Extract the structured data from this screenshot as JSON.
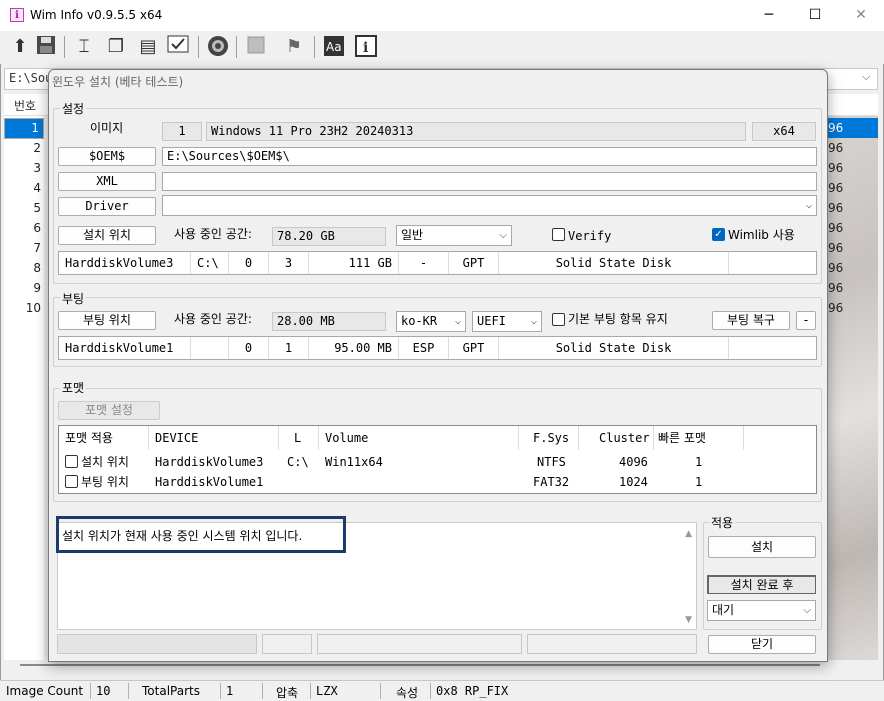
{
  "window": {
    "title": "Wim Info v0.9.5.5 x64",
    "app_icon": "i",
    "minimize": "─",
    "maximize": "☐",
    "close": "✕"
  },
  "toolbar": [
    "upload-icon",
    "save-icon",
    "split-icon",
    "copy-icon",
    "paste-icon",
    "check-icon",
    "disc-icon",
    "stop-icon",
    "flag-icon",
    "font-icon",
    "info-icon"
  ],
  "background": {
    "path": "E:\\Sou",
    "list_header": "번호",
    "row_numbers": [
      "1",
      "2",
      "3",
      "4",
      "5",
      "6",
      "7",
      "8",
      "9",
      "10"
    ],
    "right_values": [
      "96",
      "96",
      "96",
      "96",
      "96",
      "96",
      "96",
      "96",
      "96",
      "96"
    ]
  },
  "status": {
    "image_count_label": "Image Count",
    "image_count": "10",
    "total_parts_label": "TotalParts",
    "total_parts": "1",
    "compress_label": "압축",
    "compress": "LZX",
    "attr_label": "속성",
    "attr": "0x8 RP_FIX"
  },
  "dialog": {
    "title": "윈도우 설치 (베타 테스트)",
    "settings": {
      "group": "설정",
      "image_label": "이미지",
      "image_index": "1",
      "image_name": "Windows 11 Pro 23H2 20240313",
      "arch": "x64",
      "oem_button": "$OEM$",
      "oem_value": "E:\\Sources\\$OEM$\\",
      "xml_button": "XML",
      "xml_value": "",
      "driver_button": "Driver",
      "driver_value": "",
      "install_loc_button": "설치 위치",
      "space_label": "사용 중인 공간:",
      "space_value": "78.20 GB",
      "mode": "일반",
      "verify_label": "Verify",
      "verify_checked": false,
      "wimlib_label": "Wimlib 사용",
      "wimlib_checked": true,
      "disk": [
        "HarddiskVolume3",
        "C:\\",
        "0",
        "3",
        "111 GB",
        "-",
        "GPT",
        "Solid State Disk"
      ]
    },
    "boot": {
      "group": "부팅",
      "boot_loc_button": "부팅 위치",
      "space_label": "사용 중인 공간:",
      "space_value": "28.00 MB",
      "locale": "ko-KR",
      "firmware": "UEFI",
      "keep_label": "기본 부팅 항목 유지",
      "keep_checked": false,
      "restore_button": "부팅 복구",
      "minus_button": "-",
      "disk": [
        "HarddiskVolume1",
        "",
        "0",
        "1",
        "95.00 MB",
        "ESP",
        "GPT",
        "Solid State Disk"
      ]
    },
    "format": {
      "group": "포맷",
      "settings_button": "포맷 설정",
      "headers": [
        "포맷 적용",
        "DEVICE",
        "L",
        "Volume",
        "F.Sys",
        "Cluster",
        "빠른 포맷"
      ],
      "rows": [
        {
          "name": "설치 위치",
          "device": "HarddiskVolume3",
          "letter": "C:\\",
          "volume": "Win11x64",
          "fs": "NTFS",
          "cluster": "4096",
          "quick": "1"
        },
        {
          "name": "부팅 위치",
          "device": "HarddiskVolume1",
          "letter": "",
          "volume": "",
          "fs": "FAT32",
          "cluster": "1024",
          "quick": "1"
        }
      ]
    },
    "message": "설치 위치가 현재 사용 중인 시스템 위치 입니다.",
    "apply": {
      "group": "적용",
      "install_button": "설치",
      "after_label": "설치 완료 후",
      "after_value": "대기",
      "close_button": "닫기"
    }
  }
}
